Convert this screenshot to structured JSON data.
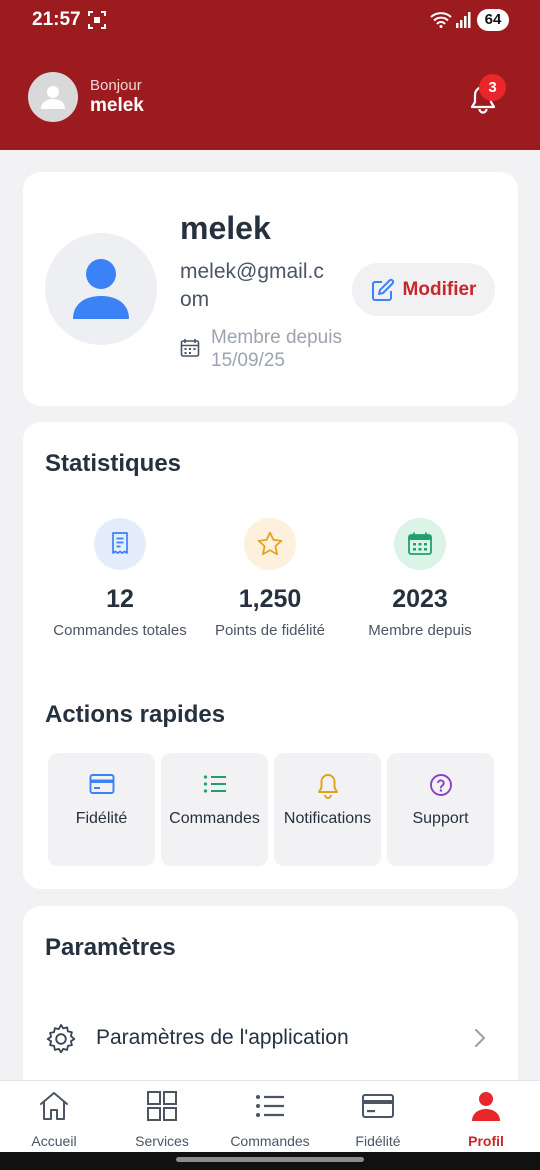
{
  "status_bar": {
    "time": "21:57",
    "battery": "64"
  },
  "header": {
    "greeting": "Bonjour",
    "user_name": "melek",
    "notification_count": "3"
  },
  "profile": {
    "name": "melek",
    "email": "melek@gmail.com",
    "member_since": "Membre depuis 15/09/25",
    "edit_label": "Modifier"
  },
  "stats": {
    "title": "Statistiques",
    "items": [
      {
        "value": "12",
        "label": "Commandes totales",
        "icon": "receipt-icon",
        "bg": "#e3edfb",
        "fg": "#3b82f6"
      },
      {
        "value": "1,250",
        "label": "Points de fidélité",
        "icon": "star-icon",
        "bg": "#fdf0dc",
        "fg": "#e0a21b"
      },
      {
        "value": "2023",
        "label": "Membre depuis",
        "icon": "calendar-icon",
        "bg": "#dcf3e8",
        "fg": "#22a06b"
      }
    ]
  },
  "quick_actions": {
    "title": "Actions rapides",
    "items": [
      {
        "label": "Fidélité",
        "icon": "card-icon",
        "color": "#3b82f6"
      },
      {
        "label": "Commandes",
        "icon": "list-icon",
        "color": "#22a06b"
      },
      {
        "label": "Notifications",
        "icon": "bell-icon",
        "color": "#e0a21b"
      },
      {
        "label": "Support",
        "icon": "help-icon",
        "color": "#8b3fc9"
      }
    ]
  },
  "settings": {
    "title": "Paramètres",
    "items": [
      {
        "label": "Paramètres de l'application"
      }
    ]
  },
  "bottom_nav": {
    "items": [
      {
        "label": "Accueil"
      },
      {
        "label": "Services"
      },
      {
        "label": "Commandes"
      },
      {
        "label": "Fidélité"
      },
      {
        "label": "Profil"
      }
    ],
    "active": "Profil"
  },
  "colors": {
    "brand": "#9b1b1e",
    "accent": "#c62828",
    "badge": "#e8262c"
  }
}
